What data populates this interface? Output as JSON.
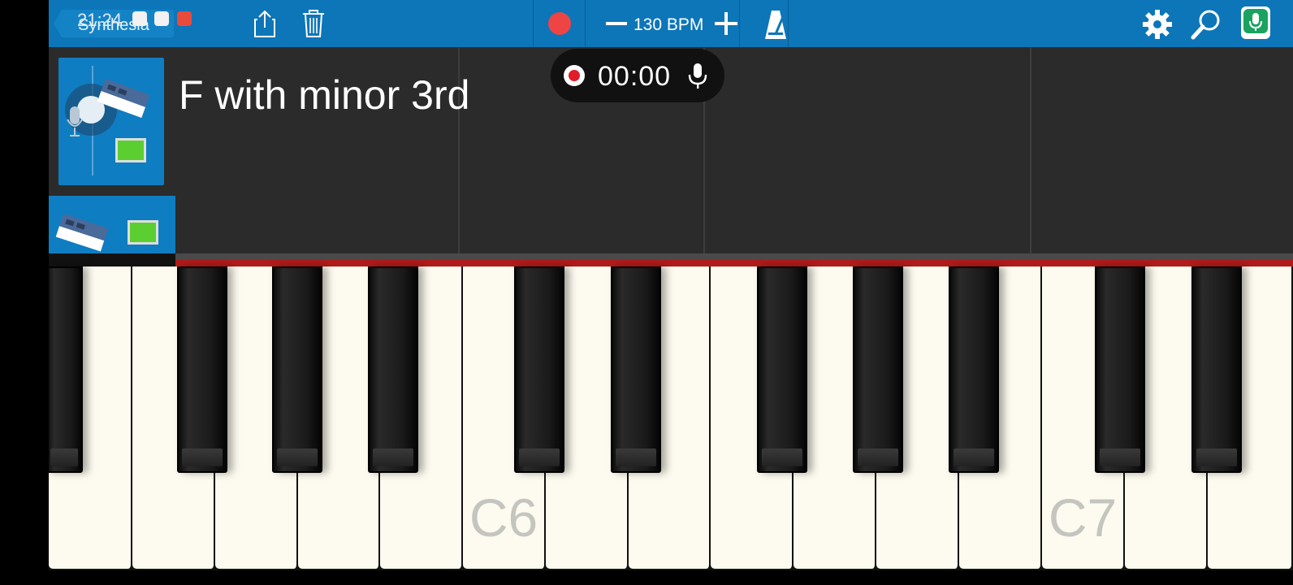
{
  "status_bar": {
    "time": "21:24"
  },
  "toolbar": {
    "back_label": "Synthesia",
    "tempo": "130 BPM",
    "icons": [
      "share-icon",
      "trash-icon",
      "record-icon",
      "minus-icon",
      "plus-icon",
      "metronome-icon",
      "gear-icon",
      "search-icon",
      "mic-icon"
    ],
    "accent_color": "#0d76b8",
    "record_color": "#ef4444"
  },
  "track": {
    "region_title": "F with minor 3rd"
  },
  "recorder": {
    "time": "00:00"
  },
  "keyboard": {
    "labels": {
      "c6": "C6",
      "c7": "C7"
    }
  }
}
